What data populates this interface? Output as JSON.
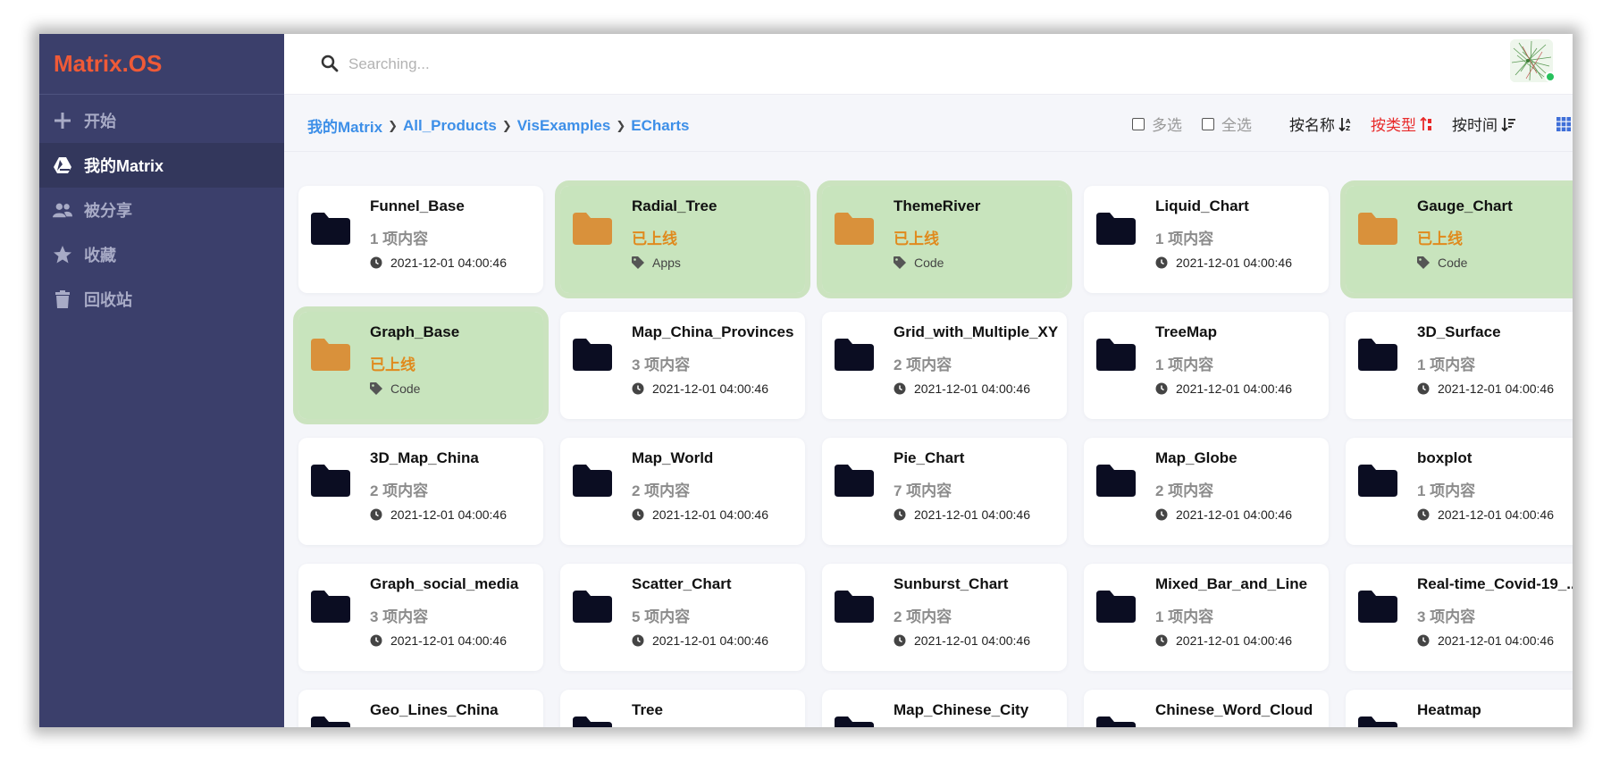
{
  "app": {
    "title": "Matrix.OS"
  },
  "colors": {
    "sidebar": "#3b3f6b",
    "accent": "#3d8fe8",
    "brand": "#ef5a37",
    "online_bg": "#c8e4bd",
    "online_text": "#e08a1d",
    "active_sort": "#e82a2a"
  },
  "sidebar": {
    "items": [
      {
        "label": "开始",
        "icon": "plus-icon"
      },
      {
        "label": "我的Matrix",
        "icon": "drive-icon"
      },
      {
        "label": "被分享",
        "icon": "users-icon"
      },
      {
        "label": "收藏",
        "icon": "star-icon"
      },
      {
        "label": "回收站",
        "icon": "trash-icon"
      }
    ]
  },
  "search": {
    "placeholder": "Searching..."
  },
  "breadcrumb": [
    "我的Matrix",
    "All_Products",
    "VisExamples",
    "ECharts"
  ],
  "toolbar": {
    "multi_select": "多选",
    "select_all": "全选",
    "sort_name": "按名称",
    "sort_type": "按类型",
    "sort_time": "按时间"
  },
  "cards": [
    {
      "name": "Funnel_Base",
      "sub": "1 项内容",
      "meta": "2021-12-01 04:00:46",
      "online": false
    },
    {
      "name": "Radial_Tree",
      "sub": "已上线",
      "meta": "Apps",
      "online": true
    },
    {
      "name": "ThemeRiver",
      "sub": "已上线",
      "meta": "Code",
      "online": true
    },
    {
      "name": "Liquid_Chart",
      "sub": "1 项内容",
      "meta": "2021-12-01 04:00:46",
      "online": false
    },
    {
      "name": "Gauge_Chart",
      "sub": "已上线",
      "meta": "Code",
      "online": true
    },
    {
      "name": "Graph_Base",
      "sub": "已上线",
      "meta": "Code",
      "online": true
    },
    {
      "name": "Map_China_Provinces",
      "sub": "3 项内容",
      "meta": "2021-12-01 04:00:46",
      "online": false
    },
    {
      "name": "Grid_with_Multiple_XY",
      "sub": "2 项内容",
      "meta": "2021-12-01 04:00:46",
      "online": false
    },
    {
      "name": "TreeMap",
      "sub": "1 项内容",
      "meta": "2021-12-01 04:00:46",
      "online": false
    },
    {
      "name": "3D_Surface",
      "sub": "1 项内容",
      "meta": "2021-12-01 04:00:46",
      "online": false
    },
    {
      "name": "3D_Map_China",
      "sub": "2 项内容",
      "meta": "2021-12-01 04:00:46",
      "online": false
    },
    {
      "name": "Map_World",
      "sub": "2 项内容",
      "meta": "2021-12-01 04:00:46",
      "online": false
    },
    {
      "name": "Pie_Chart",
      "sub": "7 项内容",
      "meta": "2021-12-01 04:00:46",
      "online": false
    },
    {
      "name": "Map_Globe",
      "sub": "2 项内容",
      "meta": "2021-12-01 04:00:46",
      "online": false
    },
    {
      "name": "boxplot",
      "sub": "1 项内容",
      "meta": "2021-12-01 04:00:46",
      "online": false
    },
    {
      "name": "Graph_social_media",
      "sub": "3 项内容",
      "meta": "2021-12-01 04:00:46",
      "online": false
    },
    {
      "name": "Scatter_Chart",
      "sub": "5 项内容",
      "meta": "2021-12-01 04:00:46",
      "online": false
    },
    {
      "name": "Sunburst_Chart",
      "sub": "2 项内容",
      "meta": "2021-12-01 04:00:46",
      "online": false
    },
    {
      "name": "Mixed_Bar_and_Line",
      "sub": "1 项内容",
      "meta": "2021-12-01 04:00:46",
      "online": false
    },
    {
      "name": "Real-time_Covid-19_...",
      "sub": "3 项内容",
      "meta": "2021-12-01 04:00:46",
      "online": false
    },
    {
      "name": "Geo_Lines_China",
      "sub": "",
      "meta": "",
      "online": false
    },
    {
      "name": "Tree",
      "sub": "",
      "meta": "",
      "online": false
    },
    {
      "name": "Map_Chinese_City",
      "sub": "",
      "meta": "",
      "online": false
    },
    {
      "name": "Chinese_Word_Cloud",
      "sub": "",
      "meta": "",
      "online": false
    },
    {
      "name": "Heatmap",
      "sub": "",
      "meta": "",
      "online": false
    }
  ]
}
